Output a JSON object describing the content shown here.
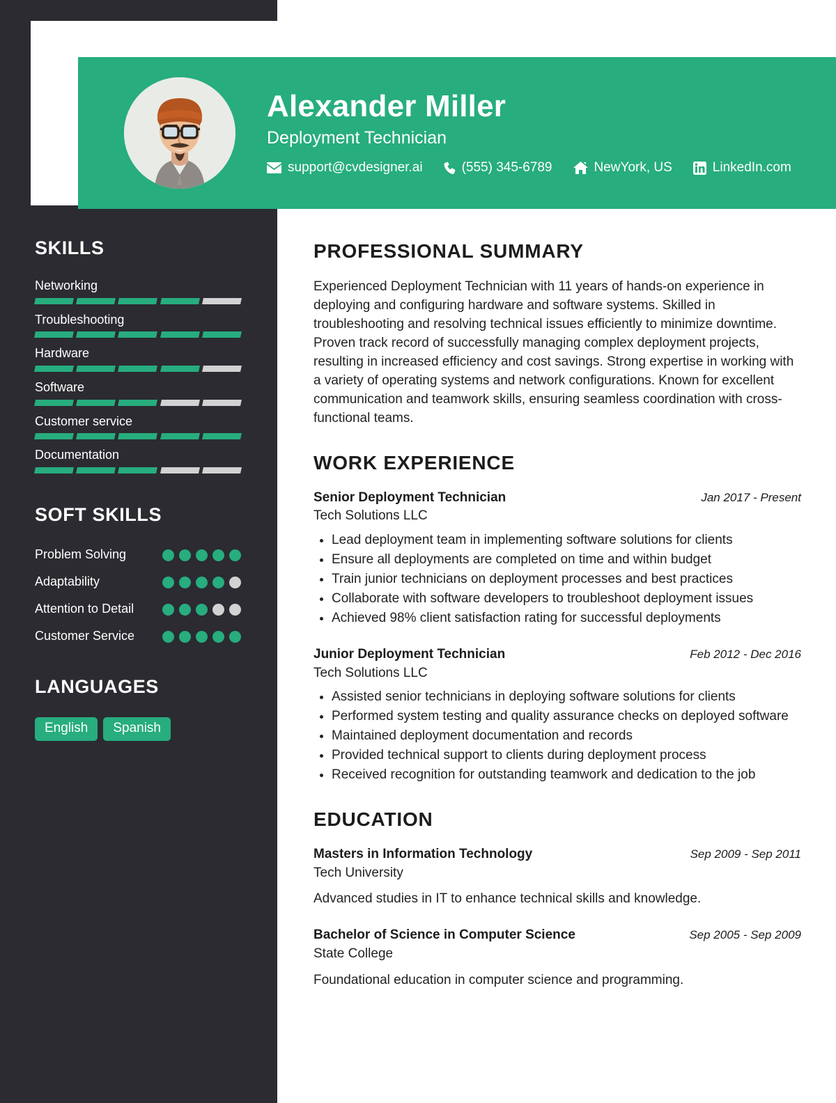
{
  "header": {
    "name": "Alexander Miller",
    "role": "Deployment Technician",
    "accent_color": "#27ad7e",
    "sidebar_color": "#2b2b31",
    "contacts": [
      {
        "icon": "envelope-icon",
        "label": "support@cvdesigner.ai"
      },
      {
        "icon": "phone-icon",
        "label": "(555) 345-6789"
      },
      {
        "icon": "home-icon",
        "label": "NewYork, US"
      },
      {
        "icon": "linkedin-icon",
        "label": "LinkedIn.com"
      }
    ]
  },
  "sidebar": {
    "skills_heading": "SKILLS",
    "skills": [
      {
        "name": "Networking",
        "level": 4,
        "max": 5
      },
      {
        "name": "Troubleshooting",
        "level": 5,
        "max": 5
      },
      {
        "name": "Hardware",
        "level": 4,
        "max": 5
      },
      {
        "name": "Software",
        "level": 3,
        "max": 5
      },
      {
        "name": "Customer service",
        "level": 5,
        "max": 5
      },
      {
        "name": "Documentation",
        "level": 3,
        "max": 5
      }
    ],
    "soft_skills_heading": "SOFT SKILLS",
    "soft_skills": [
      {
        "name": "Problem Solving",
        "level": 5,
        "max": 5
      },
      {
        "name": "Adaptability",
        "level": 4,
        "max": 5
      },
      {
        "name": "Attention to Detail",
        "level": 3,
        "max": 5
      },
      {
        "name": "Customer Service",
        "level": 5,
        "max": 5
      }
    ],
    "languages_heading": "LANGUAGES",
    "languages": [
      "English",
      "Spanish"
    ]
  },
  "main": {
    "summary_heading": "PROFESSIONAL SUMMARY",
    "summary": "Experienced Deployment Technician with 11 years of hands-on experience in deploying and configuring hardware and software systems. Skilled in troubleshooting and resolving technical issues efficiently to minimize downtime. Proven track record of successfully managing complex deployment projects, resulting in increased efficiency and cost savings. Strong expertise in working with a variety of operating systems and network configurations. Known for excellent communication and teamwork skills, ensuring seamless coordination with cross-functional teams.",
    "experience_heading": "WORK EXPERIENCE",
    "experience": [
      {
        "title": "Senior Deployment Technician",
        "date": "Jan 2017 - Present",
        "org": "Tech Solutions LLC",
        "bullets": [
          "Lead deployment team in implementing software solutions for clients",
          "Ensure all deployments are completed on time and within budget",
          "Train junior technicians on deployment processes and best practices",
          "Collaborate with software developers to troubleshoot deployment issues",
          "Achieved 98% client satisfaction rating for successful deployments"
        ]
      },
      {
        "title": "Junior Deployment Technician",
        "date": "Feb 2012 - Dec 2016",
        "org": "Tech Solutions LLC",
        "bullets": [
          "Assisted senior technicians in deploying software solutions for clients",
          "Performed system testing and quality assurance checks on deployed software",
          "Maintained deployment documentation and records",
          "Provided technical support to clients during deployment process",
          "Received recognition for outstanding teamwork and dedication to the job"
        ]
      }
    ],
    "education_heading": "EDUCATION",
    "education": [
      {
        "title": "Masters in Information Technology",
        "date": "Sep 2009 - Sep 2011",
        "org": "Tech University",
        "description": "Advanced studies in IT to enhance technical skills and knowledge."
      },
      {
        "title": "Bachelor of Science in Computer Science",
        "date": "Sep 2005 - Sep 2009",
        "org": "State College",
        "description": "Foundational education in computer science and programming."
      }
    ]
  }
}
